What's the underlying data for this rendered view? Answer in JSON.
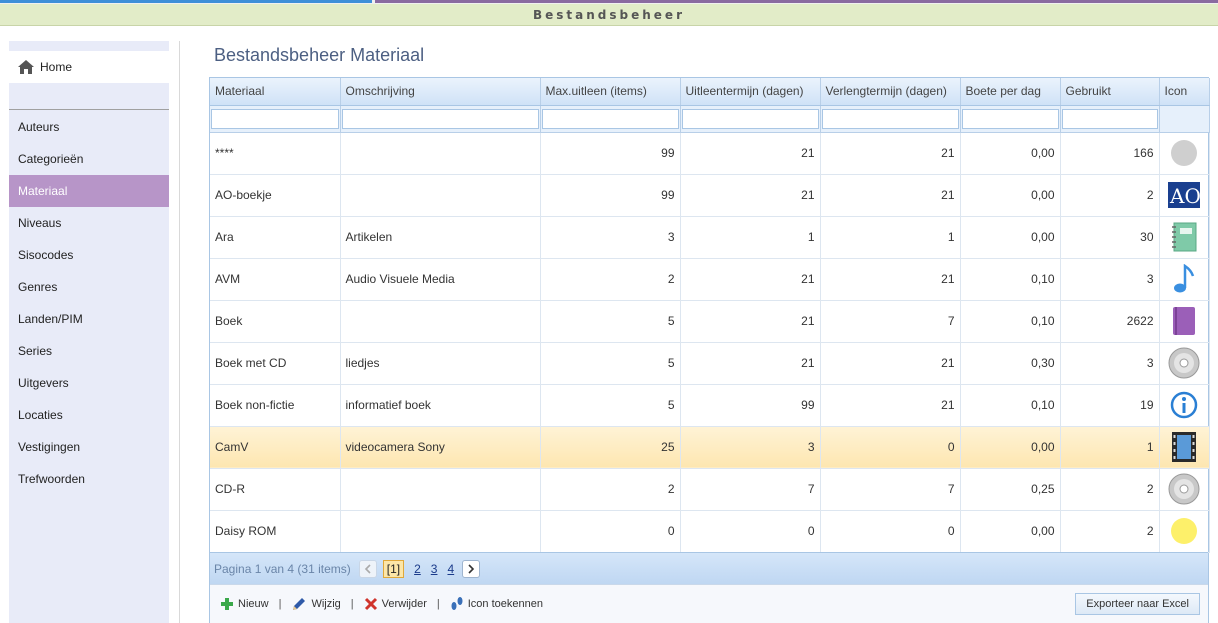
{
  "app": {
    "title": "Bestandsbeheer"
  },
  "sidebar": {
    "home_label": "Home",
    "items": [
      "Auteurs",
      "Categorieën",
      "Materiaal",
      "Niveaus",
      "Sisocodes",
      "Genres",
      "Landen/PIM",
      "Series",
      "Uitgevers",
      "Locaties",
      "Vestigingen",
      "Trefwoorden"
    ],
    "active": "Materiaal"
  },
  "page": {
    "title": "Bestandsbeheer Materiaal"
  },
  "table": {
    "headers": [
      "Materiaal",
      "Omschrijving",
      "Max.uitleen (items)",
      "Uitleentermijn (dagen)",
      "Verlengtermijn (dagen)",
      "Boete per dag",
      "Gebruikt",
      "Icon"
    ],
    "rows": [
      {
        "materiaal": "****",
        "omschrijving": "",
        "max": "99",
        "uitleen": "21",
        "verleng": "21",
        "boete": "0,00",
        "gebruikt": "166",
        "icon": "grey-circle-icon"
      },
      {
        "materiaal": "AO-boekje",
        "omschrijving": "",
        "max": "99",
        "uitleen": "21",
        "verleng": "21",
        "boete": "0,00",
        "gebruikt": "2",
        "icon": "ao-logo-icon"
      },
      {
        "materiaal": "Ara",
        "omschrijving": "Artikelen",
        "max": "3",
        "uitleen": "1",
        "verleng": "1",
        "boete": "0,00",
        "gebruikt": "30",
        "icon": "notebook-icon"
      },
      {
        "materiaal": "AVM",
        "omschrijving": "Audio Visuele Media",
        "max": "2",
        "uitleen": "21",
        "verleng": "21",
        "boete": "0,10",
        "gebruikt": "3",
        "icon": "music-note-icon"
      },
      {
        "materiaal": "Boek",
        "omschrijving": "",
        "max": "5",
        "uitleen": "21",
        "verleng": "7",
        "boete": "0,10",
        "gebruikt": "2622",
        "icon": "book-icon"
      },
      {
        "materiaal": "Boek met CD",
        "omschrijving": "liedjes",
        "max": "5",
        "uitleen": "21",
        "verleng": "21",
        "boete": "0,30",
        "gebruikt": "3",
        "icon": "cd-icon"
      },
      {
        "materiaal": "Boek non-fictie",
        "omschrijving": "informatief boek",
        "max": "5",
        "uitleen": "99",
        "verleng": "21",
        "boete": "0,10",
        "gebruikt": "19",
        "icon": "info-icon"
      },
      {
        "materiaal": "CamV",
        "omschrijving": "videocamera Sony",
        "max": "25",
        "uitleen": "3",
        "verleng": "0",
        "boete": "0,00",
        "gebruikt": "1",
        "icon": "film-icon"
      },
      {
        "materiaal": "CD-R",
        "omschrijving": "",
        "max": "2",
        "uitleen": "7",
        "verleng": "7",
        "boete": "0,25",
        "gebruikt": "2",
        "icon": "cd-icon"
      },
      {
        "materiaal": "Daisy ROM",
        "omschrijving": "",
        "max": "0",
        "uitleen": "0",
        "verleng": "0",
        "boete": "0,00",
        "gebruikt": "2",
        "icon": "yellow-circle-icon"
      }
    ],
    "selected_row": "CamV"
  },
  "pager": {
    "info": "Pagina 1 van 4 (31 items)",
    "current": "[1]",
    "pages": [
      "2",
      "3",
      "4"
    ]
  },
  "toolbar": {
    "new_label": "Nieuw",
    "edit_label": "Wijzig",
    "delete_label": "Verwijder",
    "icon_label": "Icon toekennen",
    "export_label": "Exporteer naar Excel"
  },
  "colors": {
    "active_nav": "#b795c8",
    "selected_row": "#fde6b0",
    "header_bar": "#e2ecc8",
    "title": "#4c5f82"
  }
}
